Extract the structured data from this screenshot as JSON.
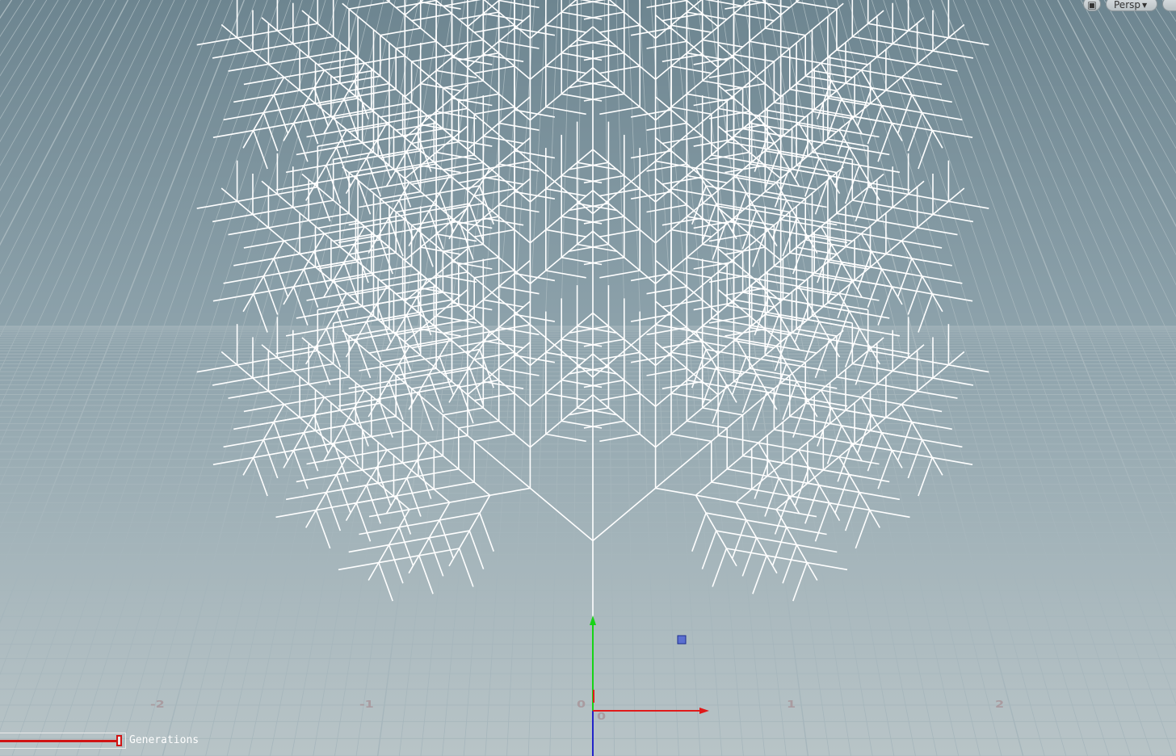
{
  "viewport": {
    "camera_label": "Persp",
    "colors": {
      "bg_top": "#6d8590",
      "bg_bottom": "#b8c4c7",
      "grid": "#a6b6bc",
      "geometry": "#ffffff",
      "x_axis": "#e01a1a",
      "y_axis": "#17d317",
      "z_axis": "#2323c8"
    }
  },
  "axis_labels": {
    "x_neg2": "-2",
    "x_neg1": "-1",
    "x_0": "0",
    "x_1": "1",
    "x_2": "2",
    "origin_0": "0"
  },
  "tree": {
    "depth": 5,
    "branch_angle_deg": 50,
    "length_ratio": 0.5
  },
  "slider": {
    "label": "Generations",
    "value_fraction": 1.0
  }
}
